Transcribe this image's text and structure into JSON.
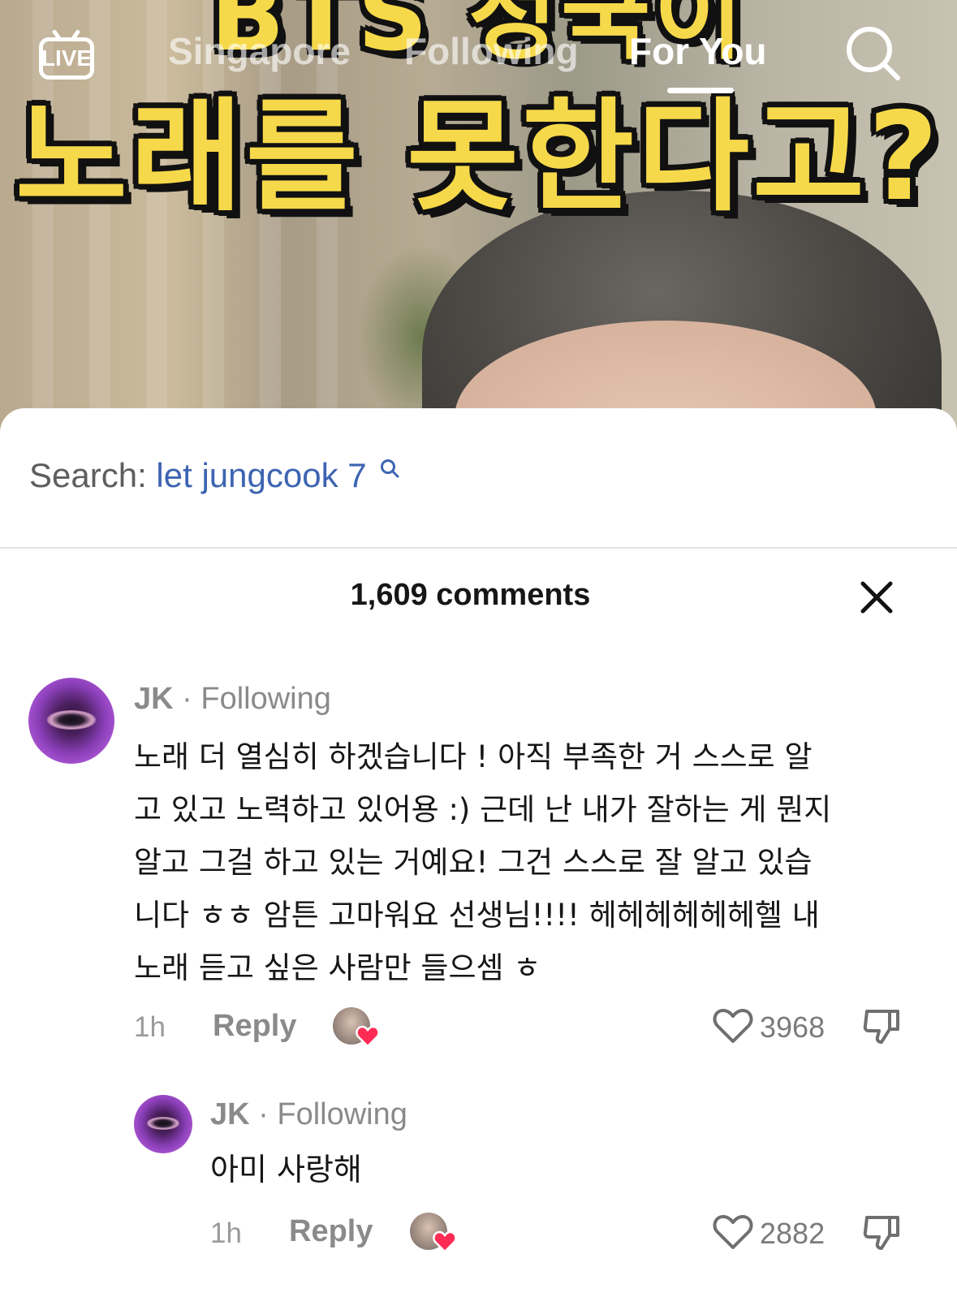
{
  "video": {
    "overlay_line1": "BTS 정국이",
    "overlay_line2": "노래를 못한다고?"
  },
  "top_nav": {
    "live_label": "LIVE",
    "tabs": [
      {
        "label": "Singapore",
        "active": false
      },
      {
        "label": "Following",
        "active": false
      },
      {
        "label": "For You",
        "active": true
      }
    ],
    "search_icon": "search-icon"
  },
  "comments_sheet": {
    "search_prefix": "Search:",
    "search_query": "let jungcook 7",
    "comment_count": "1,609 comments",
    "close_icon": "close-icon",
    "comments": [
      {
        "author": "JK",
        "separator": "·",
        "relation": "Following",
        "lines": [
          "노래 더 열심히 하겠습니다 ! 아직 부족한 거 스스로 알",
          "고 있고 노력하고 있어용 :) 근데 난 내가 잘하는 게 뭔지",
          "알고 그걸 하고 있는 거예요! 그건 스스로 잘 알고 있습",
          "니다 ㅎㅎ 암튼 고마워요 선생님!!!! 헤헤헤헤헤헤헬 내",
          "노래 듣고 싶은 사람만 들으셈 ㅎ"
        ],
        "time": "1h",
        "reply_label": "Reply",
        "likes": "3968"
      },
      {
        "author": "JK",
        "separator": "·",
        "relation": "Following",
        "lines": [
          "아미 사랑해"
        ],
        "time": "1h",
        "reply_label": "Reply",
        "likes": "2882"
      }
    ]
  },
  "colors": {
    "link_blue": "#3d64b1",
    "overlay_yellow": "#f6d94a",
    "heart_red": "#fe2c55"
  }
}
